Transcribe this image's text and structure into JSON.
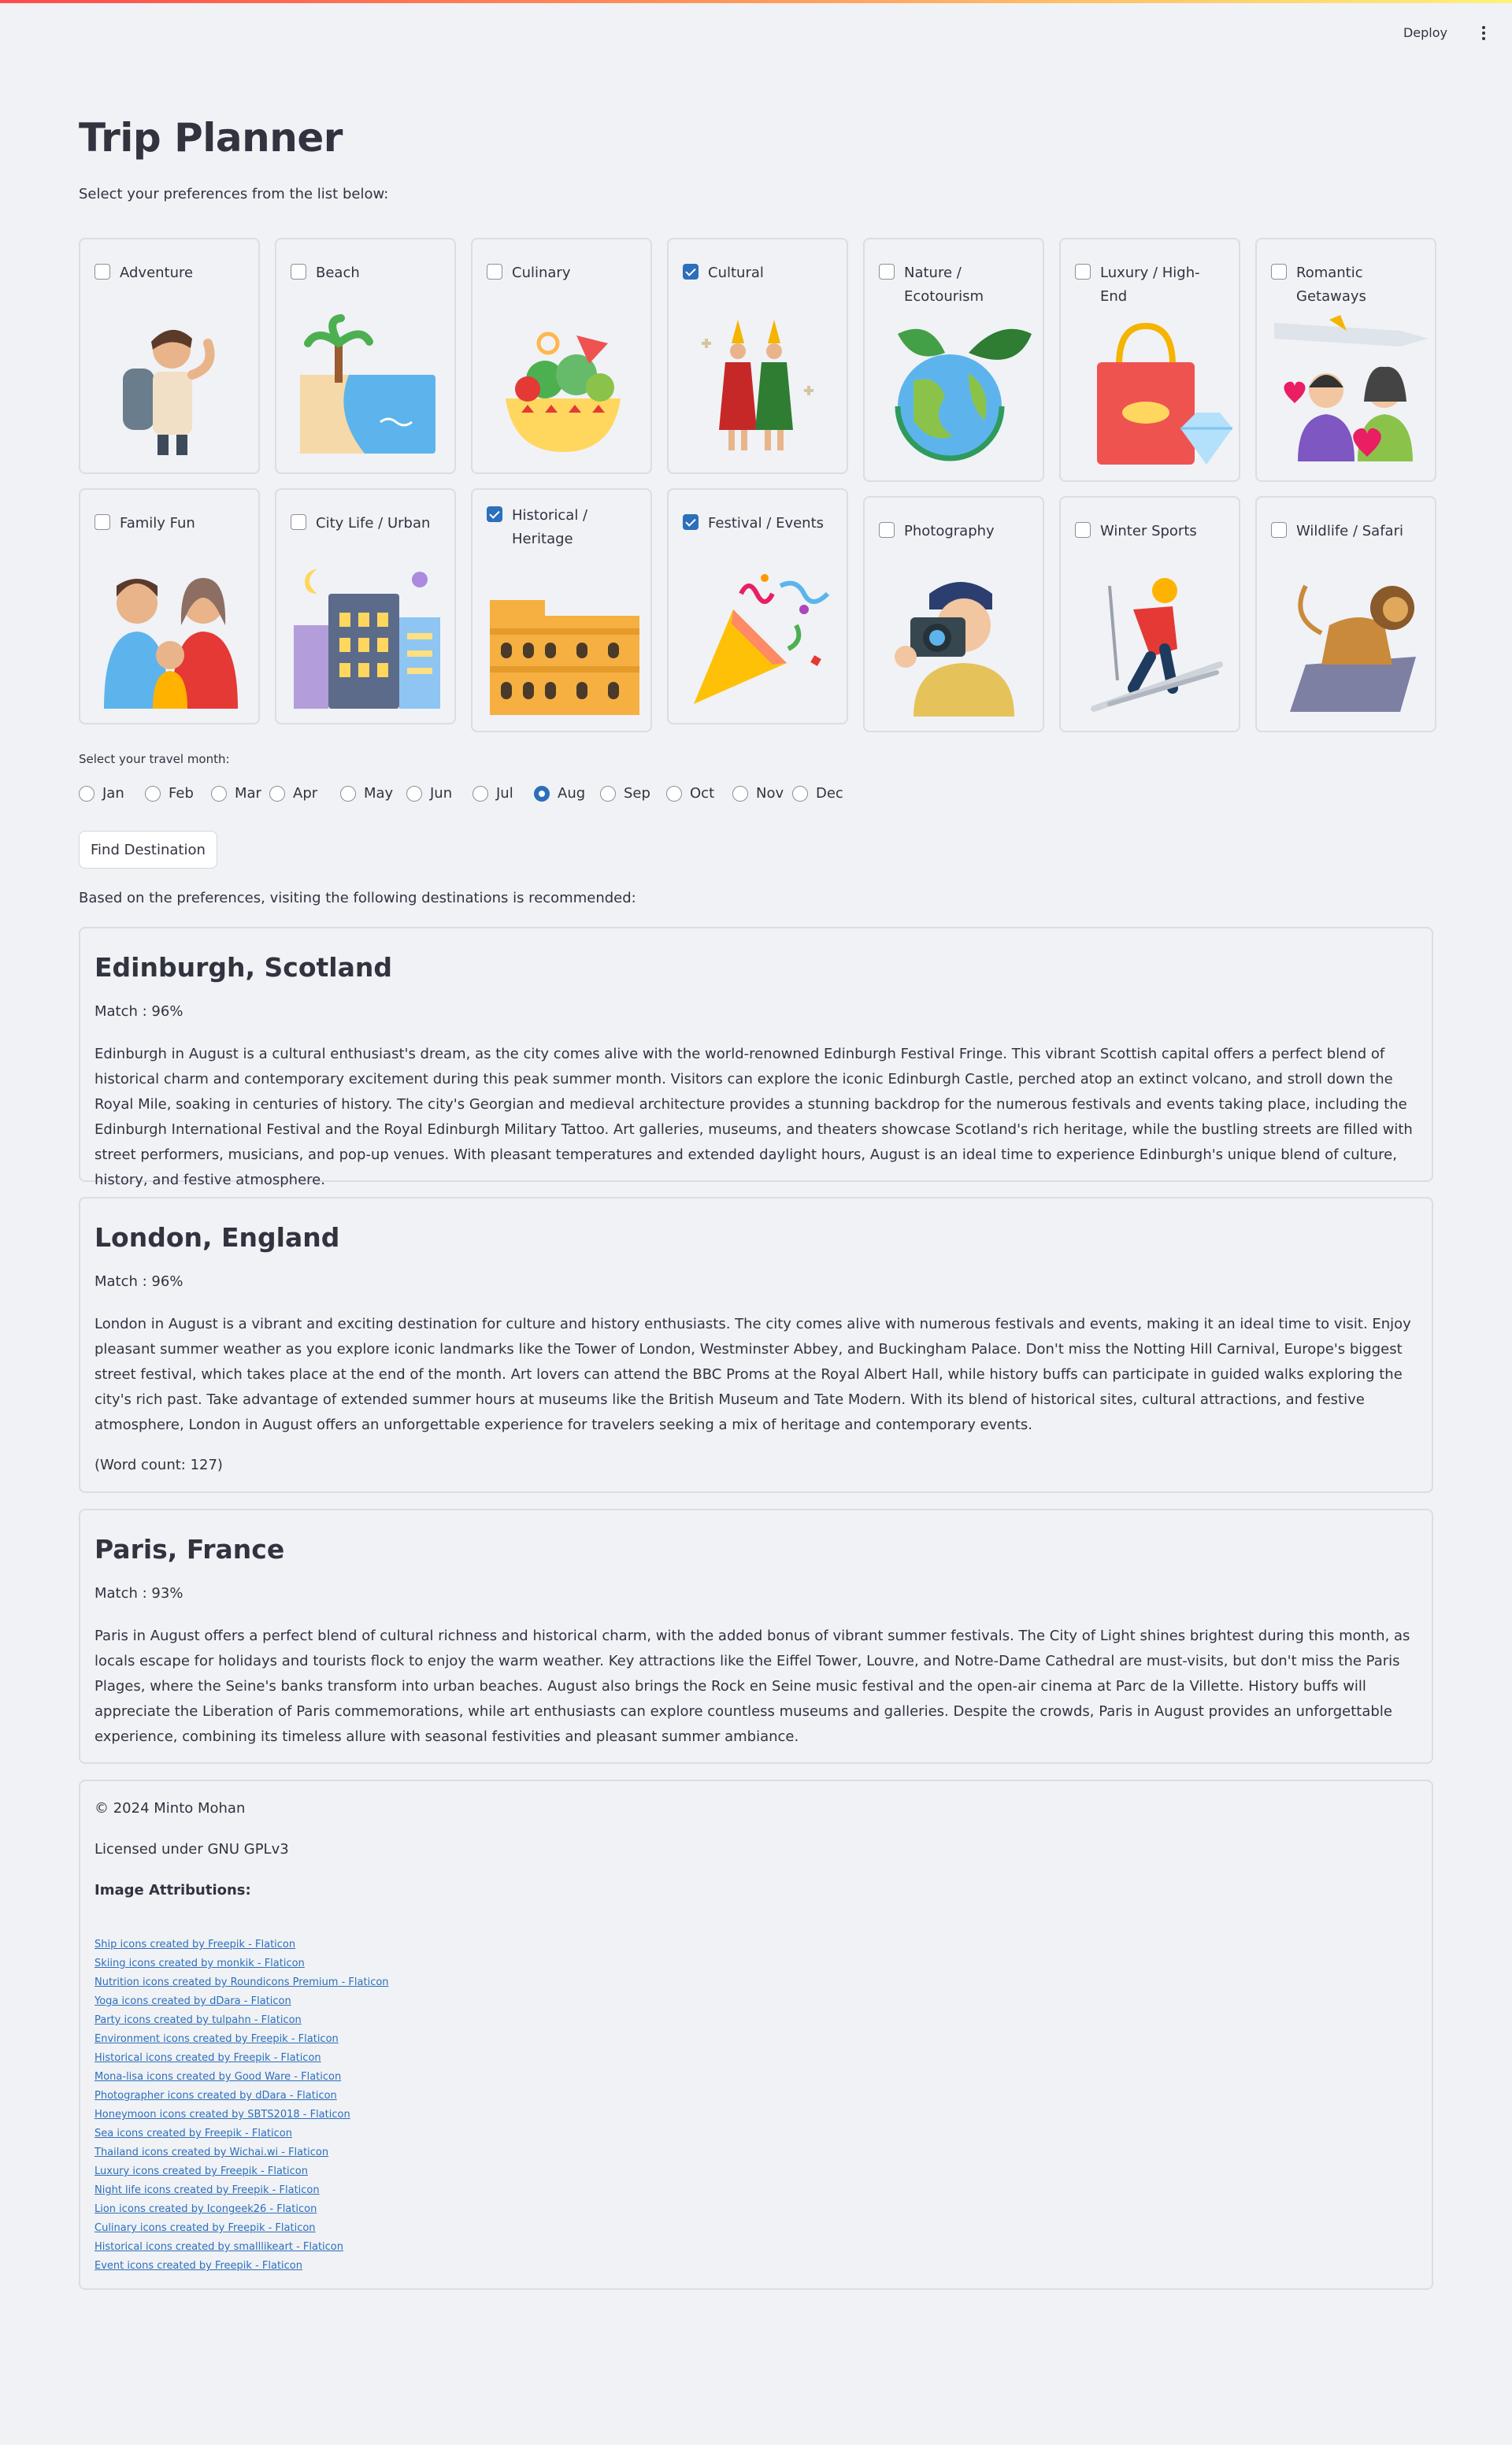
{
  "header": {
    "deploy_label": "Deploy",
    "menu_icon": "kebab-menu-icon"
  },
  "page": {
    "title": "Trip Planner",
    "subtitle": "Select your preferences from the list below:"
  },
  "preferences": [
    {
      "label": "Adventure",
      "checked": false,
      "icon": "backpacker-icon"
    },
    {
      "label": "Beach",
      "checked": false,
      "icon": "beach-icon"
    },
    {
      "label": "Culinary",
      "checked": false,
      "icon": "salad-bowl-icon"
    },
    {
      "label": "Cultural",
      "checked": true,
      "icon": "dancers-icon"
    },
    {
      "label": "Nature / Ecotourism",
      "checked": false,
      "icon": "eco-globe-icon"
    },
    {
      "label": "Luxury / High-End",
      "checked": false,
      "icon": "luxury-bag-icon"
    },
    {
      "label": "Romantic Getaways",
      "checked": false,
      "icon": "couple-icon"
    },
    {
      "label": "Family Fun",
      "checked": false,
      "icon": "family-icon"
    },
    {
      "label": "City Life / Urban",
      "checked": false,
      "icon": "city-icon"
    },
    {
      "label": "Historical / Heritage",
      "checked": true,
      "icon": "colosseum-icon"
    },
    {
      "label": "Festival / Events",
      "checked": true,
      "icon": "party-popper-icon"
    },
    {
      "label": "Photography",
      "checked": false,
      "icon": "photographer-icon"
    },
    {
      "label": "Winter Sports",
      "checked": false,
      "icon": "skier-icon"
    },
    {
      "label": "Wildlife / Safari",
      "checked": false,
      "icon": "lion-icon"
    }
  ],
  "month_picker": {
    "label": "Select your travel month:",
    "options": [
      "Jan",
      "Feb",
      "Mar",
      "Apr",
      "May",
      "Jun",
      "Jul",
      "Aug",
      "Sep",
      "Oct",
      "Nov",
      "Dec"
    ],
    "selected": "Aug"
  },
  "find_button": "Find Destination",
  "recommend_text": "Based on the preferences, visiting the following destinations is recommended:",
  "destinations": [
    {
      "name": "Edinburgh, Scotland",
      "match": "Match : 96%",
      "description": "Edinburgh in August is a cultural enthusiast's dream, as the city comes alive with the world-renowned Edinburgh Festival Fringe. This vibrant Scottish capital offers a perfect blend of historical charm and contemporary excitement during this peak summer month. Visitors can explore the iconic Edinburgh Castle, perched atop an extinct volcano, and stroll down the Royal Mile, soaking in centuries of history. The city's Georgian and medieval architecture provides a stunning backdrop for the numerous festivals and events taking place, including the Edinburgh International Festival and the Royal Edinburgh Military Tattoo. Art galleries, museums, and theaters showcase Scotland's rich heritage, while the bustling streets are filled with street performers, musicians, and pop-up venues. With pleasant temperatures and extended daylight hours, August is an ideal time to experience Edinburgh's unique blend of culture, history, and festive atmosphere.",
      "word_count": ""
    },
    {
      "name": "London, England",
      "match": "Match : 96%",
      "description": "London in August is a vibrant and exciting destination for culture and history enthusiasts. The city comes alive with numerous festivals and events, making it an ideal time to visit. Enjoy pleasant summer weather as you explore iconic landmarks like the Tower of London, Westminster Abbey, and Buckingham Palace. Don't miss the Notting Hill Carnival, Europe's biggest street festival, which takes place at the end of the month. Art lovers can attend the BBC Proms at the Royal Albert Hall, while history buffs can participate in guided walks exploring the city's rich past. Take advantage of extended summer hours at museums like the British Museum and Tate Modern. With its blend of historical sites, cultural attractions, and festive atmosphere, London in August offers an unforgettable experience for travelers seeking a mix of heritage and contemporary events.",
      "word_count": "(Word count: 127)"
    },
    {
      "name": "Paris, France",
      "match": "Match : 93%",
      "description": "Paris in August offers a perfect blend of cultural richness and historical charm, with the added bonus of vibrant summer festivals. The City of Light shines brightest during this month, as locals escape for holidays and tourists flock to enjoy the warm weather. Key attractions like the Eiffel Tower, Louvre, and Notre-Dame Cathedral are must-visits, but don't miss the Paris Plages, where the Seine's banks transform into urban beaches. August also brings the Rock en Seine music festival and the open-air cinema at Parc de la Villette. History buffs will appreciate the Liberation of Paris commemorations, while art enthusiasts can explore countless museums and galleries. Despite the crowds, Paris in August provides an unforgettable experience, combining its timeless allure with seasonal festivities and pleasant summer ambiance.",
      "word_count": ""
    }
  ],
  "footer": {
    "copyright": "© 2024 Minto Mohan",
    "license": "Licensed under GNU GPLv3",
    "attributions_heading": "Image Attributions:",
    "attributions": [
      "Ship icons created by Freepik - Flaticon",
      "Skiing icons created by monkik - Flaticon",
      "Nutrition icons created by Roundicons Premium - Flaticon",
      "Yoga icons created by dDara - Flaticon",
      "Party icons created by tulpahn - Flaticon",
      "Environment icons created by Freepik - Flaticon",
      "Historical icons created by Freepik - Flaticon",
      "Mona-lisa icons created by Good Ware - Flaticon",
      "Photographer icons created by dDara - Flaticon",
      "Honeymoon icons created by SBTS2018 - Flaticon",
      "Sea icons created by Freepik - Flaticon",
      "Thailand icons created by Wichai.wi - Flaticon",
      "Luxury icons created by Freepik - Flaticon",
      "Night life icons created by Freepik - Flaticon",
      "Lion icons created by Icongeek26 - Flaticon",
      "Culinary icons created by Freepik - Flaticon",
      "Historical icons created by smalllikeart - Flaticon",
      "Event icons created by Freepik - Flaticon"
    ]
  },
  "colors": {
    "accent": "#2c6fbb",
    "background": "#f0f2f6",
    "text": "#31333f"
  }
}
